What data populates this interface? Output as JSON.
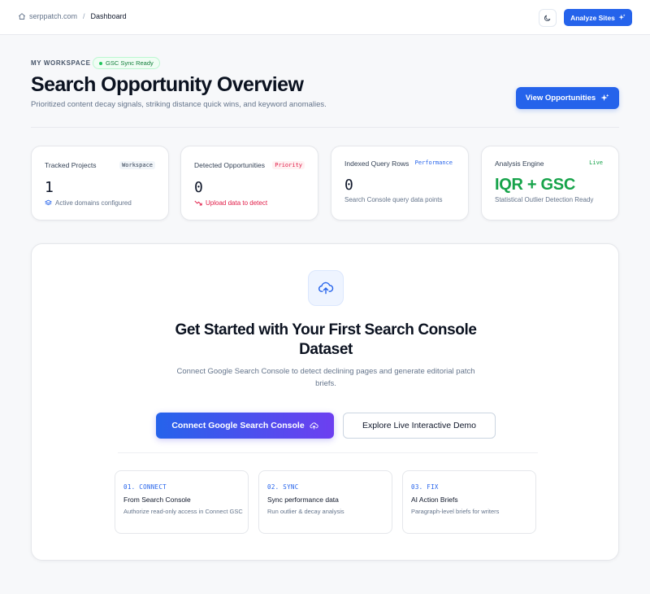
{
  "breadcrumb": {
    "site": "serppatch.com",
    "separator": "/",
    "current": "Dashboard"
  },
  "topbar": {
    "analyze_label": "Analyze Sites"
  },
  "header": {
    "workspace_label": "MY WORKSPACE",
    "sync_badge": "GSC Sync Ready",
    "title": "Search Opportunity Overview",
    "subtitle": "Prioritized content decay signals, striking distance quick wins, and keyword anomalies.",
    "view_button": "View Opportunities"
  },
  "stats": [
    {
      "title": "Tracked Projects",
      "tag": "Workspace",
      "value": "1",
      "note": "Active domains configured"
    },
    {
      "title": "Detected Opportunities",
      "tag": "Priority",
      "value": "0",
      "note": "Upload data to detect"
    },
    {
      "title": "Indexed Query Rows",
      "tag": "Performance",
      "value": "0",
      "note": "Search Console query data points"
    },
    {
      "title": "Analysis Engine",
      "tag": "Live",
      "value": "IQR + GSC",
      "note": "Statistical Outlier Detection Ready"
    }
  ],
  "hero": {
    "title": "Get Started with Your First Search Console Dataset",
    "subtitle": "Connect Google Search Console to detect declining pages and generate editorial patch briefs.",
    "connect_button": "Connect Google Search Console",
    "demo_button": "Explore Live Interactive Demo"
  },
  "steps": [
    {
      "num": "01. CONNECT",
      "title": "From Search Console",
      "desc": "Authorize read-only access in Connect GSC"
    },
    {
      "num": "02. SYNC",
      "title": "Sync performance data",
      "desc": "Run outlier & decay analysis"
    },
    {
      "num": "03. FIX",
      "title": "AI Action Briefs",
      "desc": "Paragraph-level briefs for writers"
    }
  ],
  "colors": {
    "accent": "#2563eb",
    "success": "#16a34a",
    "danger": "#e11d48",
    "gradient_end": "#6d3ff0"
  }
}
